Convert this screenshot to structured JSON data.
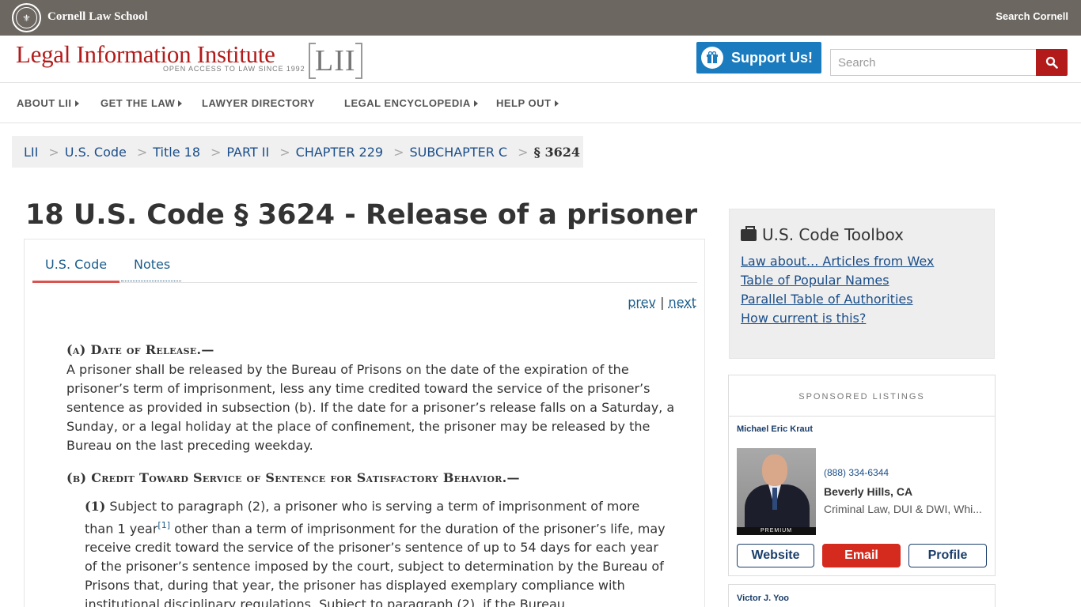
{
  "topbar": {
    "school": "Cornell Law School",
    "search": "Search Cornell"
  },
  "header": {
    "title": "Legal Information Institute",
    "tagline": "OPEN ACCESS TO LAW SINCE 1992",
    "mark": "LII",
    "support_label": "Support Us!",
    "search_placeholder": "Search"
  },
  "nav": {
    "items": [
      {
        "label": "ABOUT LII"
      },
      {
        "label": "GET THE LAW"
      },
      {
        "label": "LAWYER DIRECTORY"
      },
      {
        "label": "LEGAL ENCYCLOPEDIA"
      },
      {
        "label": "HELP OUT"
      }
    ]
  },
  "breadcrumb": {
    "items": [
      "LII",
      "U.S. Code",
      "Title 18",
      "PART II",
      "CHAPTER 229",
      "SUBCHAPTER C"
    ],
    "current": "§ 3624",
    "separator": ">"
  },
  "page": {
    "title": "18 U.S. Code § 3624 - Release of a prisoner",
    "tabs": [
      "U.S. Code",
      "Notes"
    ],
    "prev": "prev",
    "next": "next",
    "pager_separator": "|"
  },
  "content": {
    "a_heading": "(a) Date of Release.—",
    "a_text": "A prisoner shall be released by the Bureau of Prisons on the date of the expiration of the prisoner’s term of imprisonment, less any time credited toward the service of the prisoner’s sentence as provided in subsection (b). If the date for a prisoner’s release falls on a Saturday, a Sunday, or a legal holiday at the place of confinement, the prisoner may be released by the Bureau on the last preceding weekday.",
    "b_heading": "(b) Credit Toward Service of Sentence for Satisfactory Behavior.—",
    "b1_num": "(1)",
    "b1_text_start": "Subject to paragraph (2), a prisoner who is serving a term of imprisonment of more than 1 year",
    "b1_footnote": "[1]",
    "b1_text_rest": "other than a term of imprisonment for the duration of the prisoner’s life, may receive credit toward the service of the prisoner’s sentence of up to 54 days for each year of the prisoner’s sentence imposed by the court, subject to determination by the Bureau of Prisons that, during that year, the prisoner has displayed exemplary compliance with institutional disciplinary regulations. Subject to paragraph (2), if the Bureau"
  },
  "toolbox": {
    "title": "U.S. Code Toolbox",
    "links": [
      "Law about... Articles from Wex",
      "Table of Popular Names",
      "Parallel Table of Authorities",
      "How current is this?"
    ]
  },
  "sponsored": {
    "heading": "SPONSORED LISTINGS",
    "listing1": {
      "name": "Michael Eric Kraut",
      "phone": "(888) 334-6344",
      "city": "Beverly Hills, CA",
      "practice": "Criminal Law, DUI & DWI, Whi...",
      "badge": "PREMIUM",
      "website": "Website",
      "email": "Email",
      "profile": "Profile"
    },
    "listing2": {
      "name": "Victor J. Yoo"
    }
  },
  "colors": {
    "topbar": "#6c6760",
    "brand_red": "#b31b1b",
    "support_blue": "#1a7bbf",
    "link_blue": "#1a4e8a",
    "tab_underline": "#d9534f",
    "email_red": "#d52b1e"
  }
}
